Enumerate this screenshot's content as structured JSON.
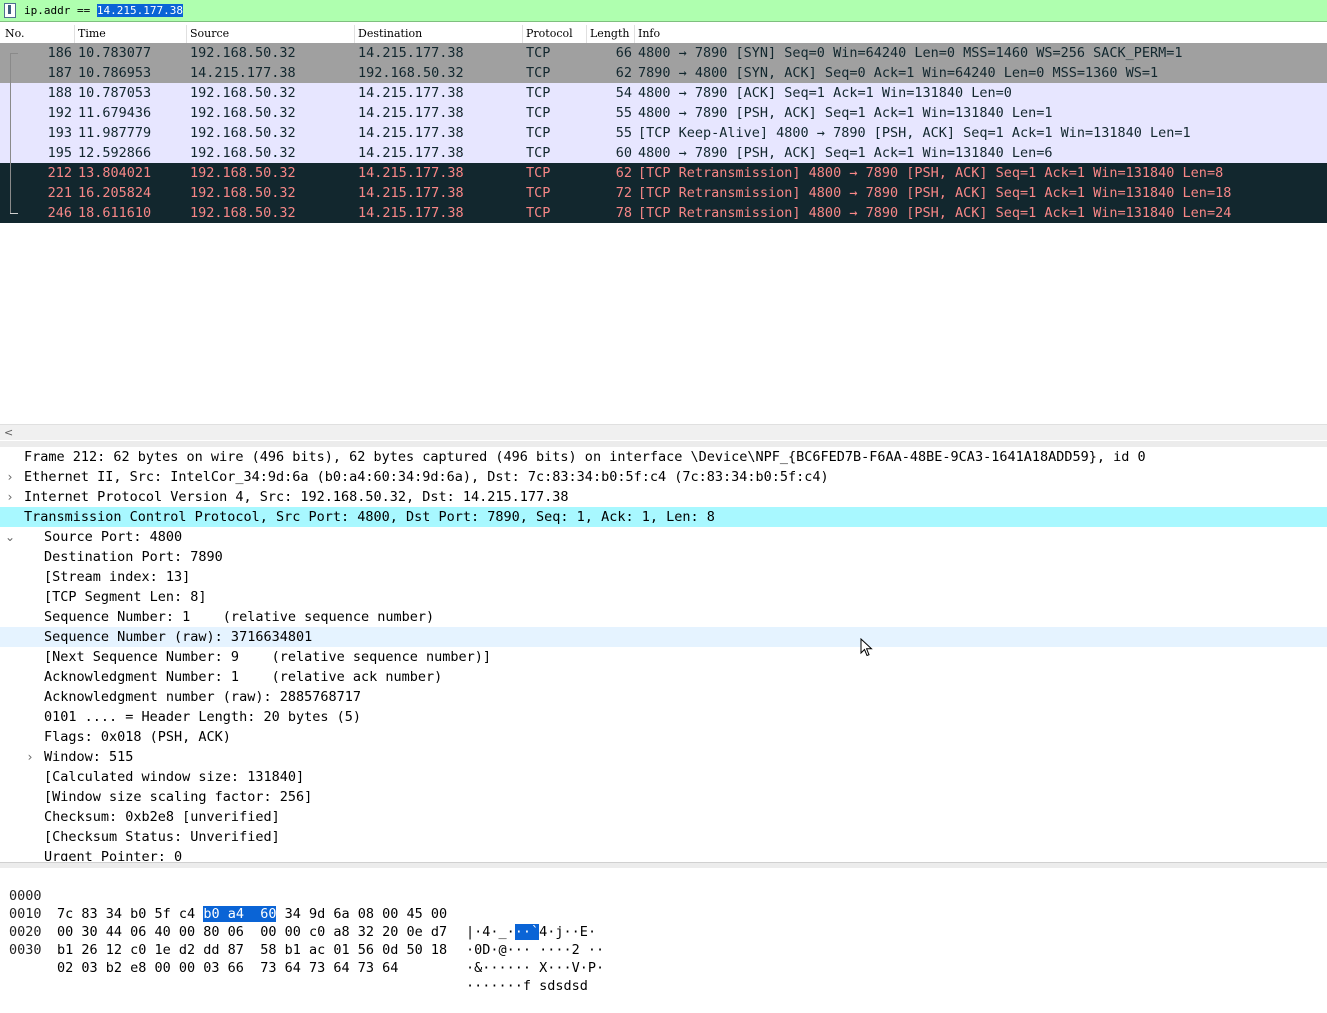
{
  "filter": {
    "label": "ip.addr == ",
    "value": "14.215.177.38"
  },
  "columns": {
    "no": "No.",
    "time": "Time",
    "source": "Source",
    "destination": "Destination",
    "protocol": "Protocol",
    "length": "Length",
    "info": "Info"
  },
  "packets": [
    {
      "no": "186",
      "time": "10.783077",
      "src": "192.168.50.32",
      "dst": "14.215.177.38",
      "proto": "TCP",
      "len": "66",
      "info": "4800 → 7890 [SYN] Seq=0 Win=64240 Len=0 MSS=1460 WS=256 SACK_PERM=1"
    },
    {
      "no": "187",
      "time": "10.786953",
      "src": "14.215.177.38",
      "dst": "192.168.50.32",
      "proto": "TCP",
      "len": "62",
      "info": "7890 → 4800 [SYN, ACK] Seq=0 Ack=1 Win=64240 Len=0 MSS=1360 WS=1"
    },
    {
      "no": "188",
      "time": "10.787053",
      "src": "192.168.50.32",
      "dst": "14.215.177.38",
      "proto": "TCP",
      "len": "54",
      "info": "4800 → 7890 [ACK] Seq=1 Ack=1 Win=131840 Len=0"
    },
    {
      "no": "192",
      "time": "11.679436",
      "src": "192.168.50.32",
      "dst": "14.215.177.38",
      "proto": "TCP",
      "len": "55",
      "info": "4800 → 7890 [PSH, ACK] Seq=1 Ack=1 Win=131840 Len=1"
    },
    {
      "no": "193",
      "time": "11.987779",
      "src": "192.168.50.32",
      "dst": "14.215.177.38",
      "proto": "TCP",
      "len": "55",
      "info": "[TCP Keep-Alive] 4800 → 7890 [PSH, ACK] Seq=1 Ack=1 Win=131840 Len=1"
    },
    {
      "no": "195",
      "time": "12.592866",
      "src": "192.168.50.32",
      "dst": "14.215.177.38",
      "proto": "TCP",
      "len": "60",
      "info": "4800 → 7890 [PSH, ACK] Seq=1 Ack=1 Win=131840 Len=6"
    },
    {
      "no": "212",
      "time": "13.804021",
      "src": "192.168.50.32",
      "dst": "14.215.177.38",
      "proto": "TCP",
      "len": "62",
      "info": "[TCP Retransmission] 4800 → 7890 [PSH, ACK] Seq=1 Ack=1 Win=131840 Len=8"
    },
    {
      "no": "221",
      "time": "16.205824",
      "src": "192.168.50.32",
      "dst": "14.215.177.38",
      "proto": "TCP",
      "len": "72",
      "info": "[TCP Retransmission] 4800 → 7890 [PSH, ACK] Seq=1 Ack=1 Win=131840 Len=18"
    },
    {
      "no": "246",
      "time": "18.611610",
      "src": "192.168.50.32",
      "dst": "14.215.177.38",
      "proto": "TCP",
      "len": "78",
      "info": "[TCP Retransmission] 4800 → 7890 [PSH, ACK] Seq=1 Ack=1 Win=131840 Len=24"
    }
  ],
  "row_colors": {
    "syn": {
      "bg": "#a0a0a0",
      "fg": "#12272e"
    },
    "tcp": {
      "bg": "#e7e6ff",
      "fg": "#12272e"
    },
    "bad": {
      "bg": "#12272e",
      "fg": "#f78787"
    }
  },
  "details": [
    {
      "text": "Frame 212: 62 bytes on wire (496 bits), 62 bytes captured (496 bits) on interface \\Device\\NPF_{BC6FED7B-F6AA-48BE-9CA3-1641A18ADD59}, id 0",
      "expander": "collapsed"
    },
    {
      "text": "Ethernet II, Src: IntelCor_34:9d:6a (b0:a4:60:34:9d:6a), Dst: 7c:83:34:b0:5f:c4 (7c:83:34:b0:5f:c4)",
      "expander": "collapsed"
    },
    {
      "text": "Internet Protocol Version 4, Src: 192.168.50.32, Dst: 14.215.177.38",
      "expander": "collapsed"
    },
    {
      "text": "Transmission Control Protocol, Src Port: 4800, Dst Port: 7890, Seq: 1, Ack: 1, Len: 8",
      "expander": "expanded"
    },
    {
      "text": "Source Port: 4800"
    },
    {
      "text": "Destination Port: 7890"
    },
    {
      "text": "[Stream index: 13]"
    },
    {
      "text": "[TCP Segment Len: 8]"
    },
    {
      "text": "Sequence Number: 1    (relative sequence number)"
    },
    {
      "text": "Sequence Number (raw): 3716634801"
    },
    {
      "text": "[Next Sequence Number: 9    (relative sequence number)]"
    },
    {
      "text": "Acknowledgment Number: 1    (relative ack number)"
    },
    {
      "text": "Acknowledgment number (raw): 2885768717"
    },
    {
      "text": "0101 .... = Header Length: 20 bytes (5)"
    },
    {
      "text": "Flags: 0x018 (PSH, ACK)",
      "expander": "collapsed"
    },
    {
      "text": "Window: 515"
    },
    {
      "text": "[Calculated window size: 131840]"
    },
    {
      "text": "[Window size scaling factor: 256]"
    },
    {
      "text": "Checksum: 0xb2e8 [unverified]"
    },
    {
      "text": "[Checksum Status: Unverified]"
    },
    {
      "text": "Urgent Pointer: 0"
    }
  ],
  "hex": [
    {
      "offset": "0000",
      "b1": "7c 83 34 b0 5f c4 ",
      "hl": "b0 a4  60",
      "b2": " 34 9d 6a 08 00 45 00",
      "a1": "|·4·_·",
      "ahl": "··`",
      "a2": "4·j··E·"
    },
    {
      "offset": "0010",
      "b1": "00 30 44 06 40 00 80 06  00 00 c0 a8 32 20 0e d7",
      "hl": "",
      "b2": "",
      "a1": "·0D·@··· ····2 ··",
      "ahl": "",
      "a2": ""
    },
    {
      "offset": "0020",
      "b1": "b1 26 12 c0 1e d2 dd 87  58 b1 ac 01 56 0d 50 18",
      "hl": "",
      "b2": "",
      "a1": "·&······ X···V·P·",
      "ahl": "",
      "a2": ""
    },
    {
      "offset": "0030",
      "b1": "02 03 b2 e8 00 00 03 66  73 64 73 64 73 64",
      "hl": "",
      "b2": "",
      "a1": "·······f sdsdsd",
      "ahl": "",
      "a2": ""
    }
  ]
}
